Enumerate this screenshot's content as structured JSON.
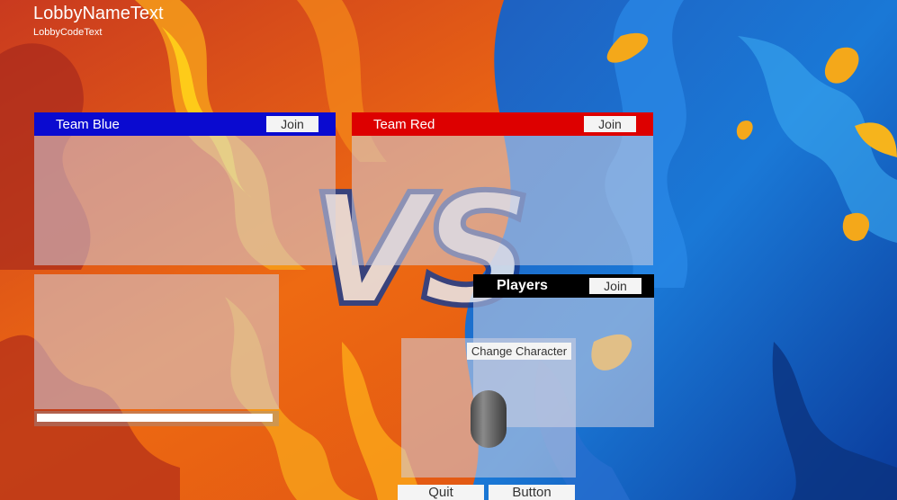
{
  "lobby": {
    "name": "LobbyNameText",
    "code": "LobbyCodeText"
  },
  "team_blue": {
    "title": "Team Blue",
    "join_label": "Join",
    "color": "#0a0ad0"
  },
  "team_red": {
    "title": "Team Red",
    "join_label": "Join",
    "color": "#dd0000"
  },
  "players": {
    "title": "Players",
    "join_label": "Join",
    "color": "#000000"
  },
  "vs_text": "VS",
  "character": {
    "change_label": "Change Character"
  },
  "footer": {
    "quit_label": "Quit",
    "button_label": "Button"
  },
  "icons": {
    "character_preview": "capsule-character-icon"
  }
}
